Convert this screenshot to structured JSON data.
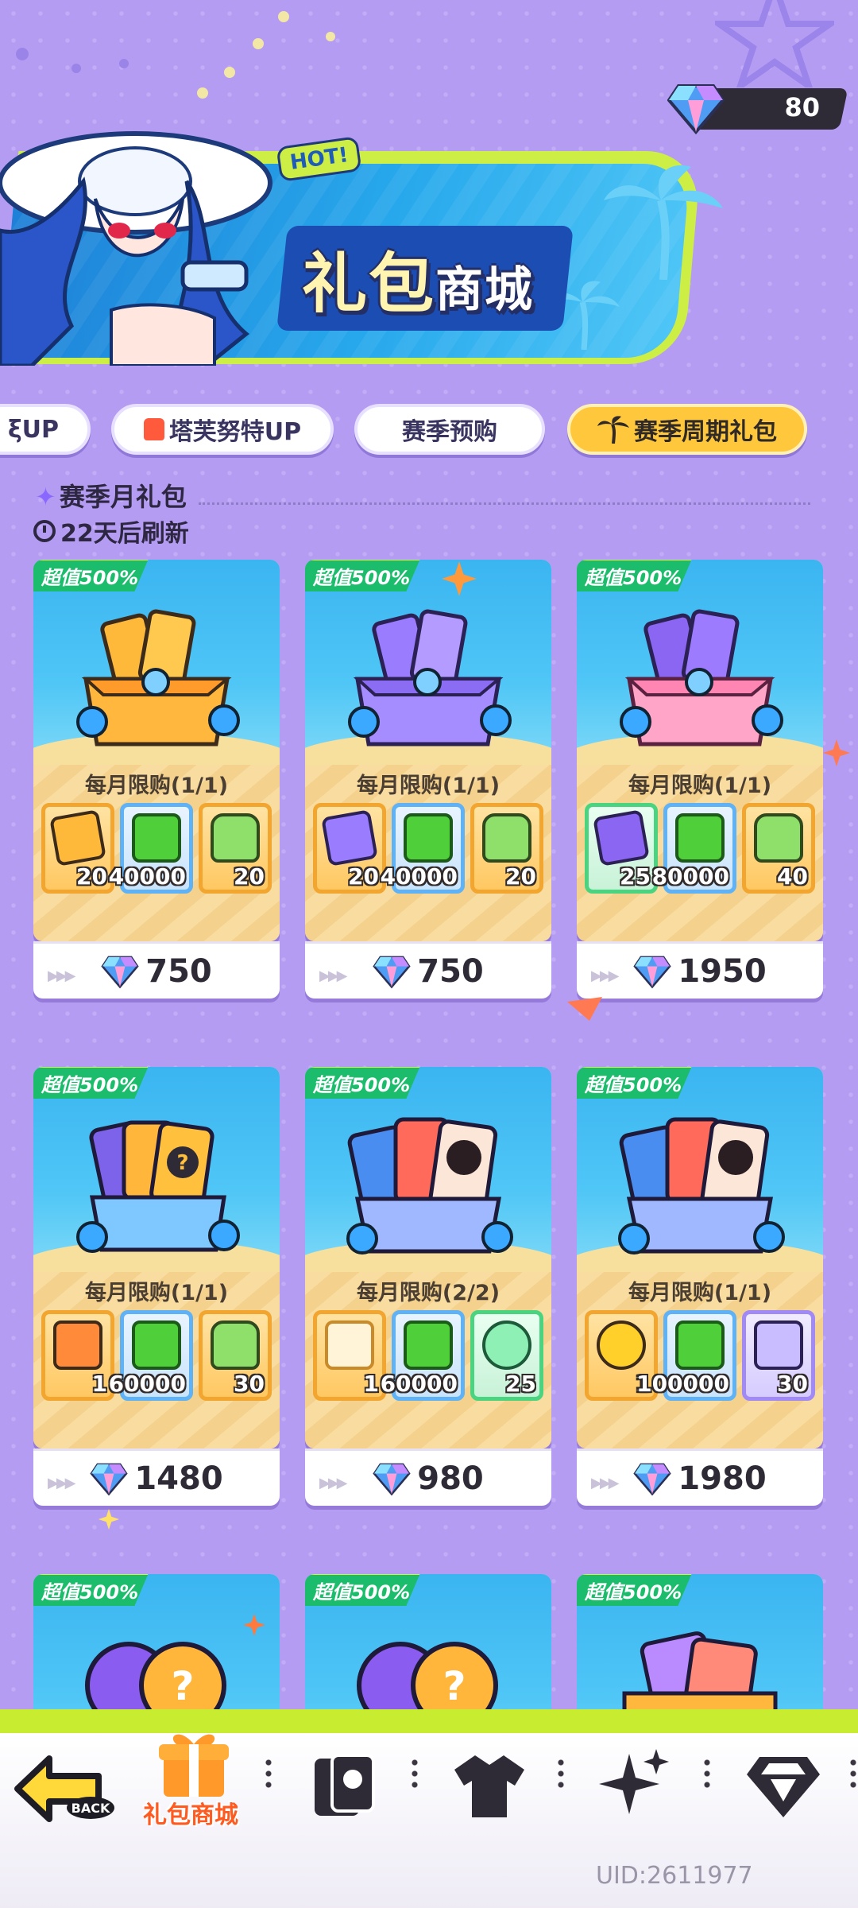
{
  "currency": {
    "amount": "80",
    "icon": "diamond-gem-icon"
  },
  "banner": {
    "hot_label": "HOT!",
    "title_part1": "礼包",
    "title_part2": "商城"
  },
  "tabs": [
    {
      "label": "ξUP",
      "active": false
    },
    {
      "label": "塔芙努特UP",
      "active": false
    },
    {
      "label": "赛季预购",
      "active": false
    },
    {
      "label": "赛季周期礼包",
      "active": true
    }
  ],
  "section": {
    "title": "赛季月礼包",
    "refresh": "22天后刷新"
  },
  "cards": [
    {
      "badge": "超值500%",
      "limit": "每月限购(1/1)",
      "price": "750",
      "items": [
        {
          "count": "20"
        },
        {
          "count": "40000"
        },
        {
          "count": "20"
        }
      ]
    },
    {
      "badge": "超值500%",
      "limit": "每月限购(1/1)",
      "price": "750",
      "items": [
        {
          "count": "20"
        },
        {
          "count": "40000"
        },
        {
          "count": "20"
        }
      ]
    },
    {
      "badge": "超值500%",
      "limit": "每月限购(1/1)",
      "price": "1950",
      "items": [
        {
          "count": "25"
        },
        {
          "count": "80000"
        },
        {
          "count": "40"
        }
      ]
    },
    {
      "badge": "超值500%",
      "limit": "每月限购(1/1)",
      "price": "1480",
      "items": [
        {
          "count": "1"
        },
        {
          "count": "60000"
        },
        {
          "count": "30"
        }
      ]
    },
    {
      "badge": "超值500%",
      "limit": "每月限购(2/2)",
      "price": "980",
      "items": [
        {
          "count": "1"
        },
        {
          "count": "60000"
        },
        {
          "count": "25"
        }
      ]
    },
    {
      "badge": "超值500%",
      "limit": "每月限购(1/1)",
      "price": "1980",
      "items": [
        {
          "count": "1"
        },
        {
          "count": "100000"
        },
        {
          "count": "30"
        }
      ]
    },
    {
      "badge": "超值500%"
    },
    {
      "badge": "超值500%"
    },
    {
      "badge": "超值500%"
    }
  ],
  "nav": {
    "back_label": "BACK",
    "gift_shop_label": "礼包商城"
  },
  "uid": "UID:2611977",
  "colors": {
    "accent_yellow": "#ffc83c",
    "lime": "#c8ec2f",
    "badge_green": "#1bbd6c",
    "bg_purple": "#b59cf3"
  }
}
